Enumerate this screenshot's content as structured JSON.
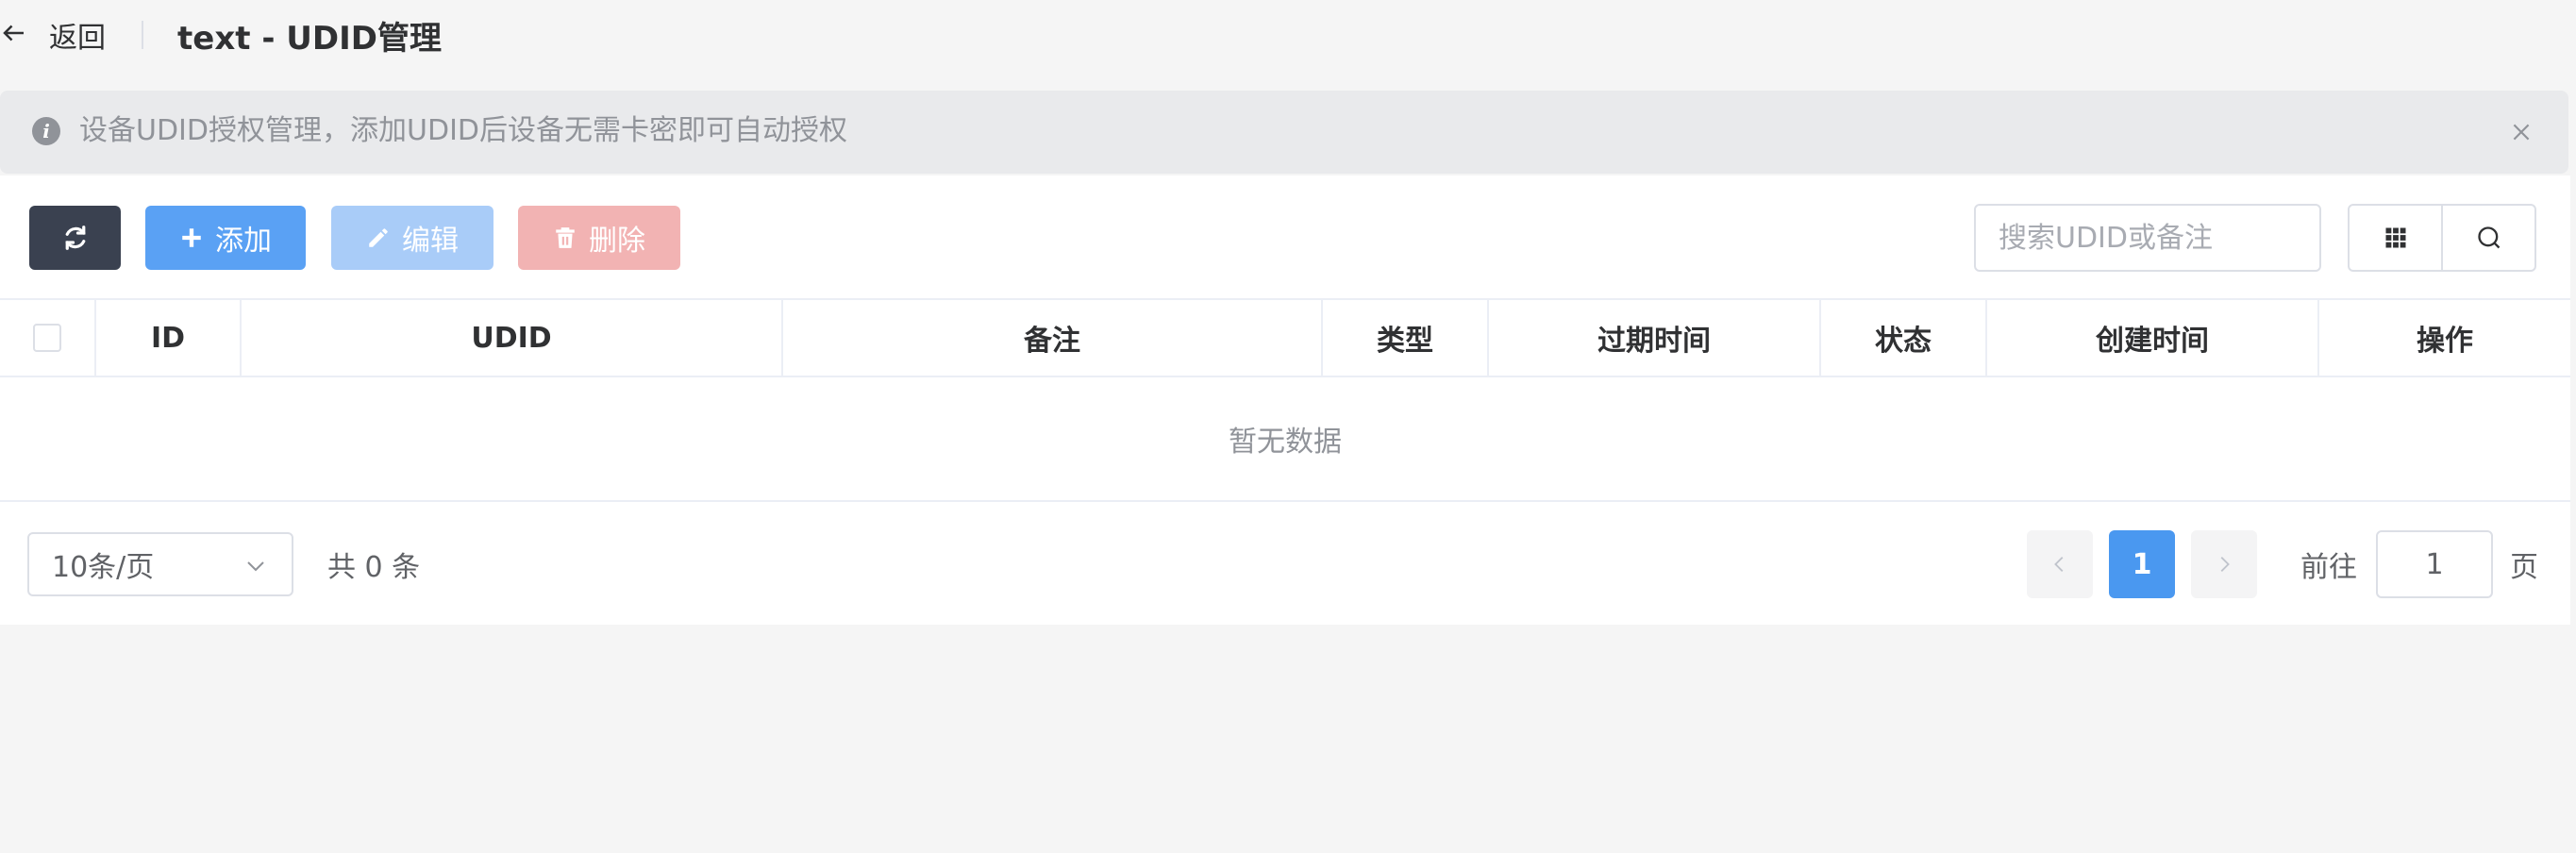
{
  "header": {
    "back_label": "返回",
    "title": "text - UDID管理"
  },
  "alert": {
    "icon": "info-icon",
    "text": "设备UDID授权管理，添加UDID后设备无需卡密即可自动授权"
  },
  "toolbar": {
    "refresh_icon": "refresh-icon",
    "add_label": "添加",
    "edit_label": "编辑",
    "delete_label": "删除",
    "search_placeholder": "搜索UDID或备注",
    "search_value": ""
  },
  "table": {
    "columns": [
      "ID",
      "UDID",
      "备注",
      "类型",
      "过期时间",
      "状态",
      "创建时间",
      "操作"
    ],
    "rows": [],
    "empty_text": "暂无数据"
  },
  "pagination": {
    "page_size": "10条/页",
    "total_text": "共 0 条",
    "current_page": "1",
    "goto_label": "前往",
    "goto_value": "1",
    "goto_unit": "页"
  },
  "colors": {
    "refresh_button": "#3a4150",
    "primary": "#5aa1f4",
    "primary_disabled": "#a9ccf8",
    "danger_disabled": "#f2b3b3",
    "active_page": "#4a98f0"
  }
}
